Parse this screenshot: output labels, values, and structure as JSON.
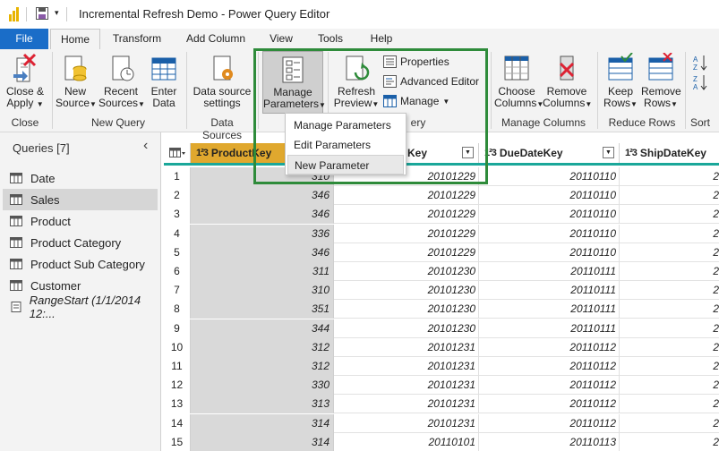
{
  "window": {
    "title": "Incremental Refresh Demo - Power Query Editor"
  },
  "tabs": [
    {
      "label": "File"
    },
    {
      "label": "Home"
    },
    {
      "label": "Transform"
    },
    {
      "label": "Add Column"
    },
    {
      "label": "View"
    },
    {
      "label": "Tools"
    },
    {
      "label": "Help"
    }
  ],
  "ribbon": {
    "close_apply": {
      "line1": "Close &",
      "line2": "Apply"
    },
    "new_source": {
      "line1": "New",
      "line2": "Source"
    },
    "recent_sources": {
      "line1": "Recent",
      "line2": "Sources"
    },
    "enter_data": {
      "line1": "Enter",
      "line2": "Data"
    },
    "data_source_settings": {
      "line1": "Data source",
      "line2": "settings"
    },
    "manage_parameters": {
      "line1": "Manage",
      "line2": "Parameters"
    },
    "refresh_preview": {
      "line1": "Refresh",
      "line2": "Preview"
    },
    "properties": "Properties",
    "advanced_editor": "Advanced Editor",
    "manage": "Manage",
    "choose_columns": {
      "line1": "Choose",
      "line2": "Columns"
    },
    "remove_columns": {
      "line1": "Remove",
      "line2": "Columns"
    },
    "keep_rows": {
      "line1": "Keep",
      "line2": "Rows"
    },
    "remove_rows": {
      "line1": "Remove",
      "line2": "Rows"
    },
    "groups": {
      "close": "Close",
      "new_query": "New Query",
      "data_sources": "Data Sources",
      "query_partial": "ery",
      "manage_columns": "Manage Columns",
      "reduce_rows": "Reduce Rows",
      "sort": "Sort"
    }
  },
  "dropdown": {
    "items": [
      "Manage Parameters",
      "Edit Parameters",
      "New Parameter"
    ],
    "hovered": "New Parameter"
  },
  "queries": {
    "header": "Queries [7]",
    "items": [
      {
        "label": "Date",
        "selected": false,
        "italic": false
      },
      {
        "label": "Sales",
        "selected": true,
        "italic": false
      },
      {
        "label": "Product",
        "selected": false,
        "italic": false
      },
      {
        "label": "Product Category",
        "selected": false,
        "italic": false
      },
      {
        "label": "Product Sub Category",
        "selected": false,
        "italic": false
      },
      {
        "label": "Customer",
        "selected": false,
        "italic": false
      },
      {
        "label": "RangeStart (1/1/2014 12:...",
        "selected": false,
        "italic": true
      }
    ]
  },
  "grid": {
    "type_label": "1²3",
    "columns": [
      "ProductKey",
      "Key",
      "DueDateKey",
      "ShipDateKey"
    ],
    "rows": [
      {
        "n": "1",
        "c1": "310",
        "c2": "20101229",
        "c3": "20110110"
      },
      {
        "n": "2",
        "c1": "346",
        "c2": "20101229",
        "c3": "20110110"
      },
      {
        "n": "3",
        "c1": "346",
        "c2": "20101229",
        "c3": "20110110"
      },
      {
        "n": "4",
        "c1": "336",
        "c2": "20101229",
        "c3": "20110110"
      },
      {
        "n": "5",
        "c1": "346",
        "c2": "20101229",
        "c3": "20110110"
      },
      {
        "n": "6",
        "c1": "311",
        "c2": "20101230",
        "c3": "20110111"
      },
      {
        "n": "7",
        "c1": "310",
        "c2": "20101230",
        "c3": "20110111"
      },
      {
        "n": "8",
        "c1": "351",
        "c2": "20101230",
        "c3": "20110111"
      },
      {
        "n": "9",
        "c1": "344",
        "c2": "20101230",
        "c3": "20110111"
      },
      {
        "n": "10",
        "c1": "312",
        "c2": "20101231",
        "c3": "20110112"
      },
      {
        "n": "11",
        "c1": "312",
        "c2": "20101231",
        "c3": "20110112"
      },
      {
        "n": "12",
        "c1": "330",
        "c2": "20101231",
        "c3": "20110112"
      },
      {
        "n": "13",
        "c1": "313",
        "c2": "20101231",
        "c3": "20110112"
      },
      {
        "n": "14",
        "c1": "314",
        "c2": "20101231",
        "c3": "20110112"
      },
      {
        "n": "15",
        "c1": "314",
        "c2": "20110101",
        "c3": "20110113"
      }
    ],
    "shipdate_partial": "2"
  },
  "colors": {
    "file_tab": "#1a6dc8",
    "highlight": "#2e8b3a",
    "key_column": "#e0a82e",
    "grid_rule": "#1aa79a"
  }
}
